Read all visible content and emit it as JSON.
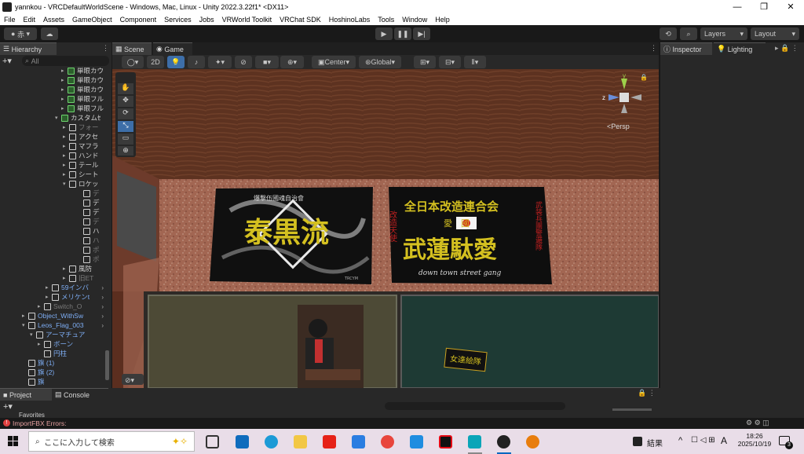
{
  "window": {
    "title": "yannkou - VRCDefaultWorldScene - Windows, Mac, Linux - Unity 2022.3.22f1* <DX11>"
  },
  "menu": [
    "File",
    "Edit",
    "Assets",
    "GameObject",
    "Component",
    "Services",
    "Jobs",
    "VRWorld Toolkit",
    "VRChat SDK",
    "HoshinoLabs",
    "Tools",
    "Window",
    "Help"
  ],
  "toolbar": {
    "account": "赤",
    "layers": "Layers",
    "layout": "Layout"
  },
  "hierarchy": {
    "tab": "Hierarchy",
    "search_placeholder": "All",
    "rows": [
      {
        "label": "単眼カウ",
        "indent": 88,
        "icon": "green",
        "arrow": "▸"
      },
      {
        "label": "単眼カウ",
        "indent": 88,
        "icon": "green",
        "arrow": "▸"
      },
      {
        "label": "単眼カウ",
        "indent": 88,
        "icon": "green",
        "arrow": "▸"
      },
      {
        "label": "単眼フル",
        "indent": 88,
        "icon": "green",
        "arrow": "▸"
      },
      {
        "label": "単眼フル",
        "indent": 88,
        "icon": "green",
        "arrow": "▸"
      },
      {
        "label": "カスタムｾ",
        "indent": 80,
        "icon": "green",
        "arrow": "▾"
      },
      {
        "label": "フォー",
        "indent": 90,
        "icon": "cube",
        "arrow": "▸",
        "dim": true
      },
      {
        "label": "アクセ",
        "indent": 90,
        "icon": "cube",
        "arrow": "▸"
      },
      {
        "label": "マフラ",
        "indent": 90,
        "icon": "cube",
        "arrow": "▸"
      },
      {
        "label": "ハンド",
        "indent": 90,
        "icon": "cube",
        "arrow": "▸"
      },
      {
        "label": "テール",
        "indent": 90,
        "icon": "cube",
        "arrow": "▸"
      },
      {
        "label": "シート",
        "indent": 90,
        "icon": "cube",
        "arrow": "▸"
      },
      {
        "label": "ロケッ",
        "indent": 90,
        "icon": "cube",
        "arrow": "▾"
      },
      {
        "label": "デ",
        "indent": 108,
        "icon": "cube",
        "arrow": "",
        "dim": true
      },
      {
        "label": "デ",
        "indent": 108,
        "icon": "cube",
        "arrow": ""
      },
      {
        "label": "デ",
        "indent": 108,
        "icon": "cube",
        "arrow": ""
      },
      {
        "label": "デ",
        "indent": 108,
        "icon": "cube",
        "arrow": "",
        "dim": true
      },
      {
        "label": "ハ",
        "indent": 108,
        "icon": "cube",
        "arrow": ""
      },
      {
        "label": "ハ",
        "indent": 108,
        "icon": "cube",
        "arrow": "",
        "dim": true
      },
      {
        "label": "ポ",
        "indent": 108,
        "icon": "cube",
        "arrow": "",
        "dim": true
      },
      {
        "label": "ポ",
        "indent": 108,
        "icon": "cube",
        "arrow": "",
        "dim": true
      },
      {
        "label": "風防",
        "indent": 90,
        "icon": "cube",
        "arrow": "▸"
      },
      {
        "label": "旧ET",
        "indent": 90,
        "icon": "cube",
        "arrow": "▸",
        "dim": true
      },
      {
        "label": "59インバ",
        "indent": 68,
        "icon": "cube",
        "arrow": "▸",
        "blue": true,
        "more": true
      },
      {
        "label": "メリケンt",
        "indent": 68,
        "icon": "cube",
        "arrow": "▸",
        "blue": true,
        "more": true
      },
      {
        "label": "Switch_O",
        "indent": 58,
        "icon": "cube",
        "arrow": "▸",
        "dim": true,
        "more": true
      },
      {
        "label": "Object_WithSw",
        "indent": 38,
        "icon": "cube",
        "arrow": "▸",
        "blue": true,
        "more": true
      },
      {
        "label": "Leos_Flag_003",
        "indent": 38,
        "icon": "cube",
        "arrow": "▾",
        "blue": true,
        "more": true
      },
      {
        "label": "アーマチュア",
        "indent": 48,
        "icon": "cube",
        "arrow": "▾",
        "blue": true
      },
      {
        "label": "ボーン",
        "indent": 58,
        "icon": "cube",
        "arrow": "▸",
        "blue": true
      },
      {
        "label": "円柱",
        "indent": 58,
        "icon": "cube",
        "arrow": "",
        "blue": true
      },
      {
        "label": "旗 (1)",
        "indent": 38,
        "icon": "cube",
        "arrow": "",
        "blue": true
      },
      {
        "label": "旗 (2)",
        "indent": 38,
        "icon": "cube",
        "arrow": "",
        "blue": true
      },
      {
        "label": "旗",
        "indent": 38,
        "icon": "cube",
        "arrow": "",
        "blue": true
      }
    ]
  },
  "scene": {
    "tabs": [
      "Scene",
      "Game"
    ],
    "toolbar": {
      "mode_2d": "2D",
      "pivot": "Center",
      "space": "Global"
    },
    "gizmo_label": "<Persp",
    "gizmo_axes": {
      "x": "x",
      "z": "z",
      "y": "y"
    }
  },
  "posters": {
    "left": {
      "top_text": "爆撃伍國魂自治會",
      "main_text": "泰黒流",
      "side_text": "TRCYM"
    },
    "right": {
      "top_text": "全日本改造連合会",
      "sub_text": "愛　國",
      "main_text": "武蓮駄愛",
      "left_side": "改造天使",
      "right_side": "武装兵團警邏隊",
      "bottom_text": "down town street gang"
    },
    "small_sign": "女達絵隊"
  },
  "inspector": {
    "tabs": [
      "Inspector",
      "Lighting"
    ]
  },
  "bottom": {
    "tabs": [
      "Project",
      "Console"
    ],
    "favorites": "Favorites"
  },
  "status": {
    "error": "ImportFBX Errors:"
  },
  "taskbar": {
    "search_placeholder": "ここに入力して検索",
    "tray_label": "結果",
    "ime": "A",
    "time": "18:26",
    "date": "2025/10/19",
    "notif_count": "3"
  },
  "colors": {
    "accent": "#2f5f9e",
    "error": "#e04040",
    "taskbar": "#e9dde8"
  }
}
